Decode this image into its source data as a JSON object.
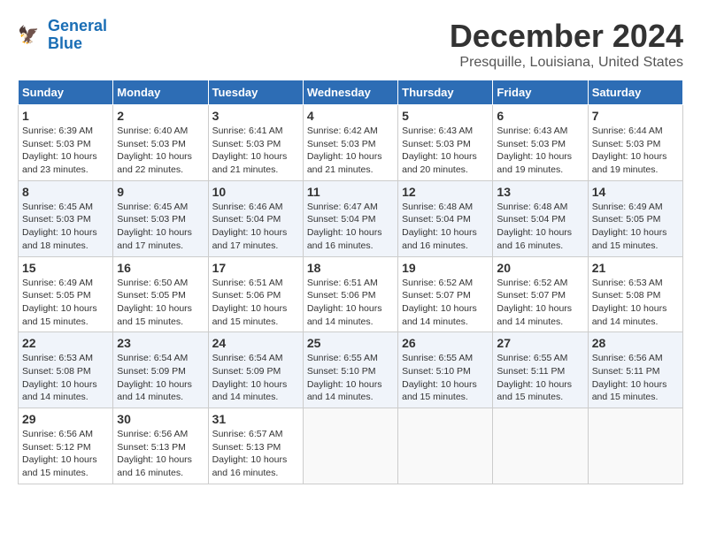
{
  "logo": {
    "line1": "General",
    "line2": "Blue"
  },
  "title": "December 2024",
  "subtitle": "Presquille, Louisiana, United States",
  "headers": [
    "Sunday",
    "Monday",
    "Tuesday",
    "Wednesday",
    "Thursday",
    "Friday",
    "Saturday"
  ],
  "weeks": [
    [
      {
        "day": "1",
        "sunrise": "6:39 AM",
        "sunset": "5:03 PM",
        "daylight": "10 hours and 23 minutes."
      },
      {
        "day": "2",
        "sunrise": "6:40 AM",
        "sunset": "5:03 PM",
        "daylight": "10 hours and 22 minutes."
      },
      {
        "day": "3",
        "sunrise": "6:41 AM",
        "sunset": "5:03 PM",
        "daylight": "10 hours and 21 minutes."
      },
      {
        "day": "4",
        "sunrise": "6:42 AM",
        "sunset": "5:03 PM",
        "daylight": "10 hours and 21 minutes."
      },
      {
        "day": "5",
        "sunrise": "6:43 AM",
        "sunset": "5:03 PM",
        "daylight": "10 hours and 20 minutes."
      },
      {
        "day": "6",
        "sunrise": "6:43 AM",
        "sunset": "5:03 PM",
        "daylight": "10 hours and 19 minutes."
      },
      {
        "day": "7",
        "sunrise": "6:44 AM",
        "sunset": "5:03 PM",
        "daylight": "10 hours and 19 minutes."
      }
    ],
    [
      {
        "day": "8",
        "sunrise": "6:45 AM",
        "sunset": "5:03 PM",
        "daylight": "10 hours and 18 minutes."
      },
      {
        "day": "9",
        "sunrise": "6:45 AM",
        "sunset": "5:03 PM",
        "daylight": "10 hours and 17 minutes."
      },
      {
        "day": "10",
        "sunrise": "6:46 AM",
        "sunset": "5:04 PM",
        "daylight": "10 hours and 17 minutes."
      },
      {
        "day": "11",
        "sunrise": "6:47 AM",
        "sunset": "5:04 PM",
        "daylight": "10 hours and 16 minutes."
      },
      {
        "day": "12",
        "sunrise": "6:48 AM",
        "sunset": "5:04 PM",
        "daylight": "10 hours and 16 minutes."
      },
      {
        "day": "13",
        "sunrise": "6:48 AM",
        "sunset": "5:04 PM",
        "daylight": "10 hours and 16 minutes."
      },
      {
        "day": "14",
        "sunrise": "6:49 AM",
        "sunset": "5:05 PM",
        "daylight": "10 hours and 15 minutes."
      }
    ],
    [
      {
        "day": "15",
        "sunrise": "6:49 AM",
        "sunset": "5:05 PM",
        "daylight": "10 hours and 15 minutes."
      },
      {
        "day": "16",
        "sunrise": "6:50 AM",
        "sunset": "5:05 PM",
        "daylight": "10 hours and 15 minutes."
      },
      {
        "day": "17",
        "sunrise": "6:51 AM",
        "sunset": "5:06 PM",
        "daylight": "10 hours and 15 minutes."
      },
      {
        "day": "18",
        "sunrise": "6:51 AM",
        "sunset": "5:06 PM",
        "daylight": "10 hours and 14 minutes."
      },
      {
        "day": "19",
        "sunrise": "6:52 AM",
        "sunset": "5:07 PM",
        "daylight": "10 hours and 14 minutes."
      },
      {
        "day": "20",
        "sunrise": "6:52 AM",
        "sunset": "5:07 PM",
        "daylight": "10 hours and 14 minutes."
      },
      {
        "day": "21",
        "sunrise": "6:53 AM",
        "sunset": "5:08 PM",
        "daylight": "10 hours and 14 minutes."
      }
    ],
    [
      {
        "day": "22",
        "sunrise": "6:53 AM",
        "sunset": "5:08 PM",
        "daylight": "10 hours and 14 minutes."
      },
      {
        "day": "23",
        "sunrise": "6:54 AM",
        "sunset": "5:09 PM",
        "daylight": "10 hours and 14 minutes."
      },
      {
        "day": "24",
        "sunrise": "6:54 AM",
        "sunset": "5:09 PM",
        "daylight": "10 hours and 14 minutes."
      },
      {
        "day": "25",
        "sunrise": "6:55 AM",
        "sunset": "5:10 PM",
        "daylight": "10 hours and 14 minutes."
      },
      {
        "day": "26",
        "sunrise": "6:55 AM",
        "sunset": "5:10 PM",
        "daylight": "10 hours and 15 minutes."
      },
      {
        "day": "27",
        "sunrise": "6:55 AM",
        "sunset": "5:11 PM",
        "daylight": "10 hours and 15 minutes."
      },
      {
        "day": "28",
        "sunrise": "6:56 AM",
        "sunset": "5:11 PM",
        "daylight": "10 hours and 15 minutes."
      }
    ],
    [
      {
        "day": "29",
        "sunrise": "6:56 AM",
        "sunset": "5:12 PM",
        "daylight": "10 hours and 15 minutes."
      },
      {
        "day": "30",
        "sunrise": "6:56 AM",
        "sunset": "5:13 PM",
        "daylight": "10 hours and 16 minutes."
      },
      {
        "day": "31",
        "sunrise": "6:57 AM",
        "sunset": "5:13 PM",
        "daylight": "10 hours and 16 minutes."
      },
      null,
      null,
      null,
      null
    ]
  ],
  "labels": {
    "sunrise": "Sunrise:",
    "sunset": "Sunset:",
    "daylight": "Daylight:"
  }
}
